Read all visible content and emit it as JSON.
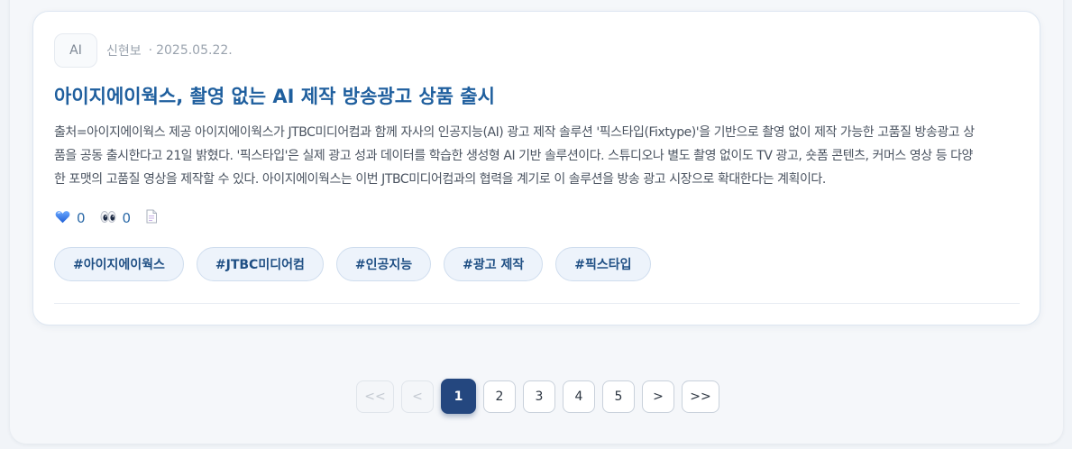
{
  "post": {
    "category": "AI",
    "author": "신현보",
    "dot": "·",
    "date": "2025.05.22.",
    "title": "아이지에이웍스, 촬영 없는 AI 제작 방송광고 상품 출시",
    "summary": "출처=아이지에이웍스 제공 아이지에이웍스가 JTBC미디어컴과 함께 자사의 인공지능(AI) 광고 제작 솔루션 '픽스타입(Fixtype)'을 기반으로 촬영 없이 제작 가능한 고품질 방송광고 상품을 공동 출시한다고 21일 밝혔다. '픽스타입'은 실제 광고 성과 데이터를 학습한 생성형 AI 기반 솔루션이다. 스튜디오나 별도 촬영 없이도 TV 광고, 숏폼 콘텐츠, 커머스 영상 등 다양한 포맷의 고품질 영상을 제작할 수 있다. 아이지에이웍스는 이번 JTBC미디어컴과의 협력을 계기로 이 솔루션을 방송 광고 시장으로 확대한다는 계획이다.",
    "likes": "0",
    "views": "0",
    "icons": {
      "like": "blue-heart-icon",
      "view": "eyes-icon",
      "doc": "document-icon"
    },
    "tags": [
      "#아이지에이웍스",
      "#JTBC미디어컴",
      "#인공지능",
      "#광고 제작",
      "#픽스타입"
    ]
  },
  "pagination": {
    "first": "<<",
    "prev": "<",
    "pages": [
      "1",
      "2",
      "3",
      "4",
      "5"
    ],
    "current": "1",
    "next": ">",
    "last": ">>"
  },
  "colors": {
    "title": "#1f5f9e",
    "tag_bg": "#edf3fb",
    "tag_text": "#1f4f84",
    "active_page": "#24477f"
  }
}
